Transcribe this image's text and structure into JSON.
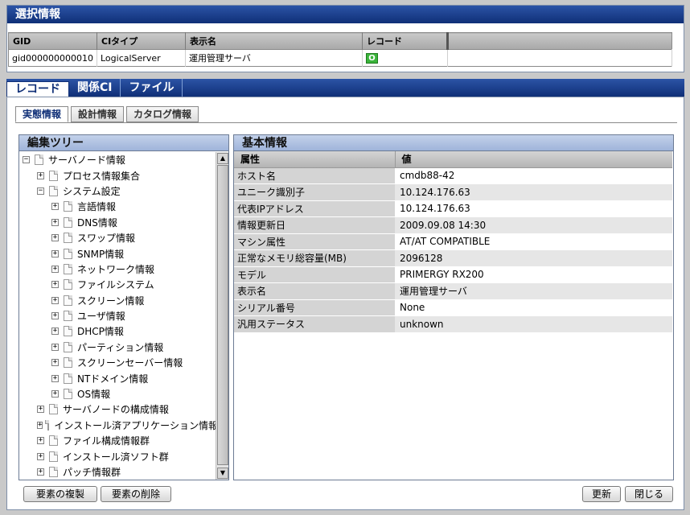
{
  "selection": {
    "title": "選択情報",
    "columns": [
      "GID",
      "CIタイプ",
      "表示名",
      "レコード"
    ],
    "row": {
      "gid": "gid000000000010",
      "ci_type": "LogicalServer",
      "display_name": "運用管理サーバ",
      "record_icon": "O"
    }
  },
  "main_tabs": [
    "レコード",
    "関係CI",
    "ファイル"
  ],
  "sub_tabs": [
    "実態情報",
    "設計情報",
    "カタログ情報"
  ],
  "tree": {
    "title": "編集ツリー",
    "items": [
      {
        "label": "サーバノード情報",
        "level": 0,
        "state": "minus"
      },
      {
        "label": "プロセス情報集合",
        "level": 1,
        "state": "plus"
      },
      {
        "label": "システム設定",
        "level": 1,
        "state": "minus"
      },
      {
        "label": "言語情報",
        "level": 2,
        "state": "plus"
      },
      {
        "label": "DNS情報",
        "level": 2,
        "state": "plus"
      },
      {
        "label": "スワップ情報",
        "level": 2,
        "state": "plus"
      },
      {
        "label": "SNMP情報",
        "level": 2,
        "state": "plus"
      },
      {
        "label": "ネットワーク情報",
        "level": 2,
        "state": "plus"
      },
      {
        "label": "ファイルシステム",
        "level": 2,
        "state": "plus"
      },
      {
        "label": "スクリーン情報",
        "level": 2,
        "state": "plus"
      },
      {
        "label": "ユーザ情報",
        "level": 2,
        "state": "plus"
      },
      {
        "label": "DHCP情報",
        "level": 2,
        "state": "plus"
      },
      {
        "label": "パーティション情報",
        "level": 2,
        "state": "plus"
      },
      {
        "label": "スクリーンセーバー情報",
        "level": 2,
        "state": "plus"
      },
      {
        "label": "NTドメイン情報",
        "level": 2,
        "state": "plus"
      },
      {
        "label": "OS情報",
        "level": 2,
        "state": "plus"
      },
      {
        "label": "サーバノードの構成情報",
        "level": 1,
        "state": "plus"
      },
      {
        "label": "インストール済アプリケーション情報",
        "level": 1,
        "state": "plus"
      },
      {
        "label": "ファイル構成情報群",
        "level": 1,
        "state": "plus"
      },
      {
        "label": "インストール済ソフト群",
        "level": 1,
        "state": "plus"
      },
      {
        "label": "パッチ情報群",
        "level": 1,
        "state": "plus"
      }
    ]
  },
  "info": {
    "title": "基本情報",
    "headers": [
      "属性",
      "値"
    ],
    "rows": [
      {
        "key": "ホスト名",
        "value": "cmdb88-42"
      },
      {
        "key": "ユニーク識別子",
        "value": "10.124.176.63"
      },
      {
        "key": "代表IPアドレス",
        "value": "10.124.176.63"
      },
      {
        "key": "情報更新日",
        "value": "2009.09.08 14:30"
      },
      {
        "key": "マシン属性",
        "value": "AT/AT COMPATIBLE"
      },
      {
        "key": "正常なメモリ総容量(MB)",
        "value": "2096128"
      },
      {
        "key": "モデル",
        "value": "PRIMERGY RX200"
      },
      {
        "key": "表示名",
        "value": "運用管理サーバ"
      },
      {
        "key": "シリアル番号",
        "value": "None"
      },
      {
        "key": "汎用ステータス",
        "value": "unknown"
      }
    ]
  },
  "buttons": {
    "duplicate": "要素の複製",
    "delete": "要素の削除",
    "refresh": "更新",
    "close": "閉じる"
  },
  "colors": {
    "header_blue": "#0f2f77",
    "record_green": "#3bb43b"
  }
}
